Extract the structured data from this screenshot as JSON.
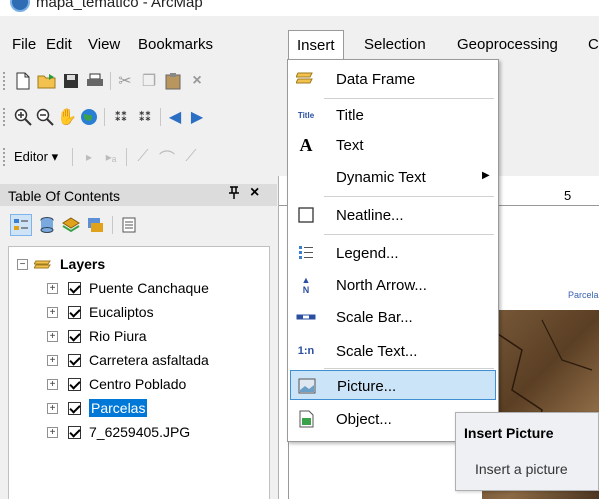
{
  "window": {
    "title": "mapa_tematico - ArcMap"
  },
  "menubar": {
    "items": [
      {
        "label": "File"
      },
      {
        "label": "Edit"
      },
      {
        "label": "View"
      },
      {
        "label": "Bookmarks"
      },
      {
        "label": "Insert"
      },
      {
        "label": "Selection"
      },
      {
        "label": "Geoprocessing"
      },
      {
        "label": "C"
      }
    ]
  },
  "toolbar3": {
    "editor_label": "Editor"
  },
  "toc": {
    "title": "Table Of Contents",
    "pin_glyph": "ᵠ",
    "close_glyph": "×",
    "root_label": "Layers",
    "layers": [
      {
        "name": "Puente Canchaque",
        "checked": true,
        "selected": false
      },
      {
        "name": "Eucaliptos",
        "checked": true,
        "selected": false
      },
      {
        "name": "Rio Piura",
        "checked": true,
        "selected": false
      },
      {
        "name": "Carretera asfaltada",
        "checked": true,
        "selected": false
      },
      {
        "name": "Centro Poblado",
        "checked": true,
        "selected": false
      },
      {
        "name": "Parcelas",
        "checked": true,
        "selected": true
      },
      {
        "name": "7_6259405.JPG",
        "checked": true,
        "selected": false
      }
    ]
  },
  "ruler": {
    "tick_label": "5"
  },
  "map": {
    "label": "Parcela"
  },
  "insert_menu": {
    "items": [
      {
        "label": "Data Frame",
        "icon": "data-frame-icon"
      },
      {
        "label": "Title",
        "icon": "title-icon",
        "icon_text": "Title"
      },
      {
        "label": "Text",
        "icon": "text-icon",
        "icon_text": "A"
      },
      {
        "label": "Dynamic Text",
        "icon": "none",
        "submenu": true
      },
      {
        "label": "Neatline...",
        "icon": "neatline-icon"
      },
      {
        "label": "Legend...",
        "icon": "legend-icon"
      },
      {
        "label": "North Arrow...",
        "icon": "north-arrow-icon",
        "icon_text": "N"
      },
      {
        "label": "Scale Bar...",
        "icon": "scale-bar-icon"
      },
      {
        "label": "Scale Text...",
        "icon": "scale-text-icon",
        "icon_text": "1:n"
      },
      {
        "label": "Picture...",
        "icon": "picture-icon",
        "highlighted": true
      },
      {
        "label": "Object...",
        "icon": "object-icon"
      }
    ]
  },
  "tooltip": {
    "title": "Insert Picture",
    "body": "Insert a picture"
  },
  "colors": {
    "selection": "#0078d7",
    "menu_highlight": "#cce4f7",
    "highlight_border": "#3f8fd2"
  }
}
